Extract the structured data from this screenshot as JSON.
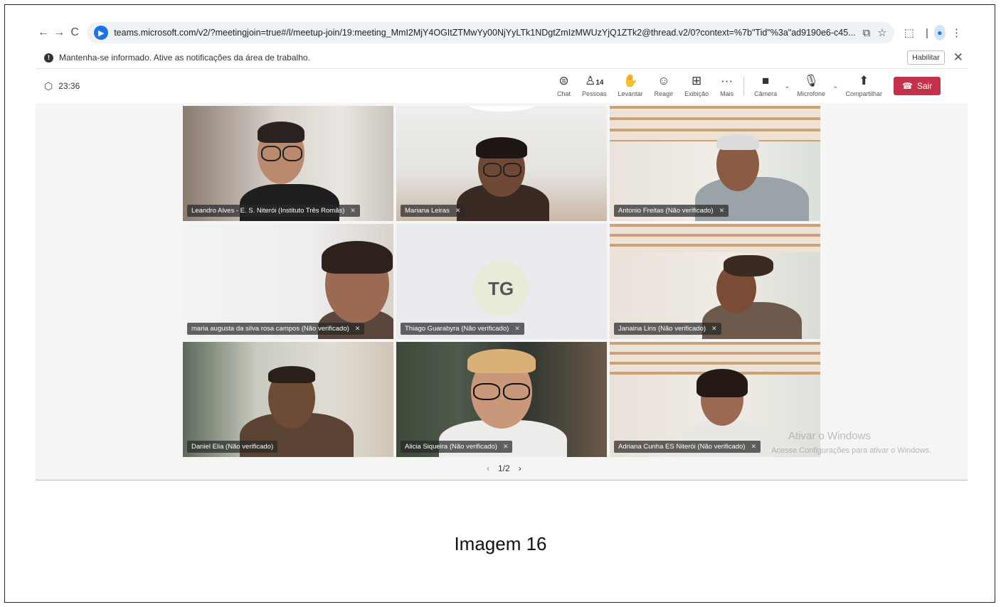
{
  "browser": {
    "url": "teams.microsoft.com/v2/?meetingjoin=true#/l/meetup-join/19:meeting_MmI2MjY4OGItZTMwYy00NjYyLTk1NDgtZmIzMWUzYjQ1ZTk2@thread.v2/0?context=%7b\"Tid\"%3a\"ad9190e6-c45...",
    "site_icon": "teams-icon",
    "back": "←",
    "forward": "→",
    "reload": "C"
  },
  "notification": {
    "text": "Mantenha-se informado. Ative as notificações da área de trabalho.",
    "enable_label": "Habilitar",
    "close": "✕"
  },
  "meeting": {
    "timer": "23:36",
    "toolbar": {
      "chat": "Chat",
      "people": "Pessoas",
      "people_count": "14",
      "raise": "Levantar",
      "react": "Reagir",
      "view": "Exibição",
      "more": "Mais",
      "camera": "Câmera",
      "mic": "Microfone",
      "share": "Compartilhar",
      "leave": "Sair"
    },
    "participants": [
      {
        "name": "Leandro Alves - E. S. Niterói (Instituto Três Romãs)"
      },
      {
        "name": "Mariana Leiras"
      },
      {
        "name": "Antonio Freitas (Não verificado)"
      },
      {
        "name": "maria augusta da silva rosa campos (Não verificado)"
      },
      {
        "name": "Thiago Guarabyra (Não verificado)",
        "initials": "TG"
      },
      {
        "name": "Janaina Lins (Não verificado)"
      },
      {
        "name": "Daniel Elia (Não verificado)"
      },
      {
        "name": "Alicia Siqueira (Não verificado)"
      },
      {
        "name": "Adriana Cunha ES Niterói (Não verificado)"
      }
    ],
    "pager": "1/2",
    "watermark_title": "Ativar o Windows",
    "watermark_sub": "Acesse Configurações para ativar o Windows."
  },
  "caption": "Imagem 16"
}
